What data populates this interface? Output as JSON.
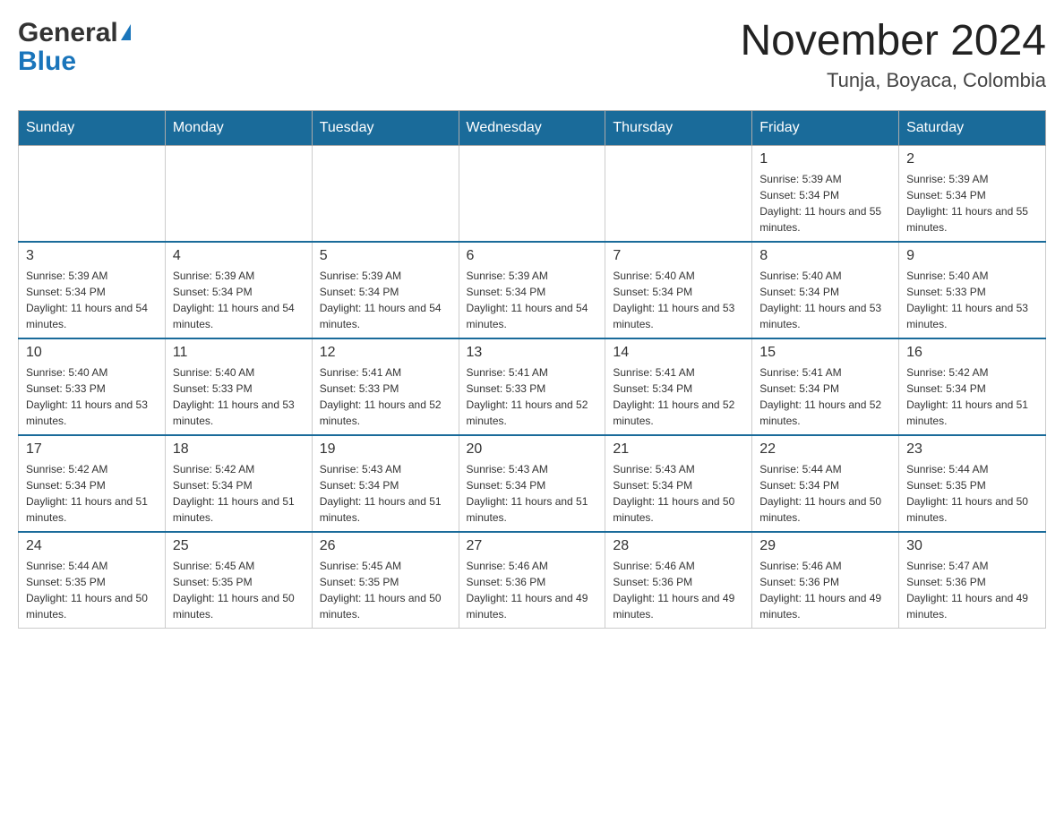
{
  "header": {
    "logo_general": "General",
    "logo_blue": "Blue",
    "month_year": "November 2024",
    "location": "Tunja, Boyaca, Colombia"
  },
  "days_of_week": [
    "Sunday",
    "Monday",
    "Tuesday",
    "Wednesday",
    "Thursday",
    "Friday",
    "Saturday"
  ],
  "weeks": [
    [
      {
        "day": "",
        "info": ""
      },
      {
        "day": "",
        "info": ""
      },
      {
        "day": "",
        "info": ""
      },
      {
        "day": "",
        "info": ""
      },
      {
        "day": "",
        "info": ""
      },
      {
        "day": "1",
        "info": "Sunrise: 5:39 AM\nSunset: 5:34 PM\nDaylight: 11 hours and 55 minutes."
      },
      {
        "day": "2",
        "info": "Sunrise: 5:39 AM\nSunset: 5:34 PM\nDaylight: 11 hours and 55 minutes."
      }
    ],
    [
      {
        "day": "3",
        "info": "Sunrise: 5:39 AM\nSunset: 5:34 PM\nDaylight: 11 hours and 54 minutes."
      },
      {
        "day": "4",
        "info": "Sunrise: 5:39 AM\nSunset: 5:34 PM\nDaylight: 11 hours and 54 minutes."
      },
      {
        "day": "5",
        "info": "Sunrise: 5:39 AM\nSunset: 5:34 PM\nDaylight: 11 hours and 54 minutes."
      },
      {
        "day": "6",
        "info": "Sunrise: 5:39 AM\nSunset: 5:34 PM\nDaylight: 11 hours and 54 minutes."
      },
      {
        "day": "7",
        "info": "Sunrise: 5:40 AM\nSunset: 5:34 PM\nDaylight: 11 hours and 53 minutes."
      },
      {
        "day": "8",
        "info": "Sunrise: 5:40 AM\nSunset: 5:34 PM\nDaylight: 11 hours and 53 minutes."
      },
      {
        "day": "9",
        "info": "Sunrise: 5:40 AM\nSunset: 5:33 PM\nDaylight: 11 hours and 53 minutes."
      }
    ],
    [
      {
        "day": "10",
        "info": "Sunrise: 5:40 AM\nSunset: 5:33 PM\nDaylight: 11 hours and 53 minutes."
      },
      {
        "day": "11",
        "info": "Sunrise: 5:40 AM\nSunset: 5:33 PM\nDaylight: 11 hours and 53 minutes."
      },
      {
        "day": "12",
        "info": "Sunrise: 5:41 AM\nSunset: 5:33 PM\nDaylight: 11 hours and 52 minutes."
      },
      {
        "day": "13",
        "info": "Sunrise: 5:41 AM\nSunset: 5:33 PM\nDaylight: 11 hours and 52 minutes."
      },
      {
        "day": "14",
        "info": "Sunrise: 5:41 AM\nSunset: 5:34 PM\nDaylight: 11 hours and 52 minutes."
      },
      {
        "day": "15",
        "info": "Sunrise: 5:41 AM\nSunset: 5:34 PM\nDaylight: 11 hours and 52 minutes."
      },
      {
        "day": "16",
        "info": "Sunrise: 5:42 AM\nSunset: 5:34 PM\nDaylight: 11 hours and 51 minutes."
      }
    ],
    [
      {
        "day": "17",
        "info": "Sunrise: 5:42 AM\nSunset: 5:34 PM\nDaylight: 11 hours and 51 minutes."
      },
      {
        "day": "18",
        "info": "Sunrise: 5:42 AM\nSunset: 5:34 PM\nDaylight: 11 hours and 51 minutes."
      },
      {
        "day": "19",
        "info": "Sunrise: 5:43 AM\nSunset: 5:34 PM\nDaylight: 11 hours and 51 minutes."
      },
      {
        "day": "20",
        "info": "Sunrise: 5:43 AM\nSunset: 5:34 PM\nDaylight: 11 hours and 51 minutes."
      },
      {
        "day": "21",
        "info": "Sunrise: 5:43 AM\nSunset: 5:34 PM\nDaylight: 11 hours and 50 minutes."
      },
      {
        "day": "22",
        "info": "Sunrise: 5:44 AM\nSunset: 5:34 PM\nDaylight: 11 hours and 50 minutes."
      },
      {
        "day": "23",
        "info": "Sunrise: 5:44 AM\nSunset: 5:35 PM\nDaylight: 11 hours and 50 minutes."
      }
    ],
    [
      {
        "day": "24",
        "info": "Sunrise: 5:44 AM\nSunset: 5:35 PM\nDaylight: 11 hours and 50 minutes."
      },
      {
        "day": "25",
        "info": "Sunrise: 5:45 AM\nSunset: 5:35 PM\nDaylight: 11 hours and 50 minutes."
      },
      {
        "day": "26",
        "info": "Sunrise: 5:45 AM\nSunset: 5:35 PM\nDaylight: 11 hours and 50 minutes."
      },
      {
        "day": "27",
        "info": "Sunrise: 5:46 AM\nSunset: 5:36 PM\nDaylight: 11 hours and 49 minutes."
      },
      {
        "day": "28",
        "info": "Sunrise: 5:46 AM\nSunset: 5:36 PM\nDaylight: 11 hours and 49 minutes."
      },
      {
        "day": "29",
        "info": "Sunrise: 5:46 AM\nSunset: 5:36 PM\nDaylight: 11 hours and 49 minutes."
      },
      {
        "day": "30",
        "info": "Sunrise: 5:47 AM\nSunset: 5:36 PM\nDaylight: 11 hours and 49 minutes."
      }
    ]
  ]
}
